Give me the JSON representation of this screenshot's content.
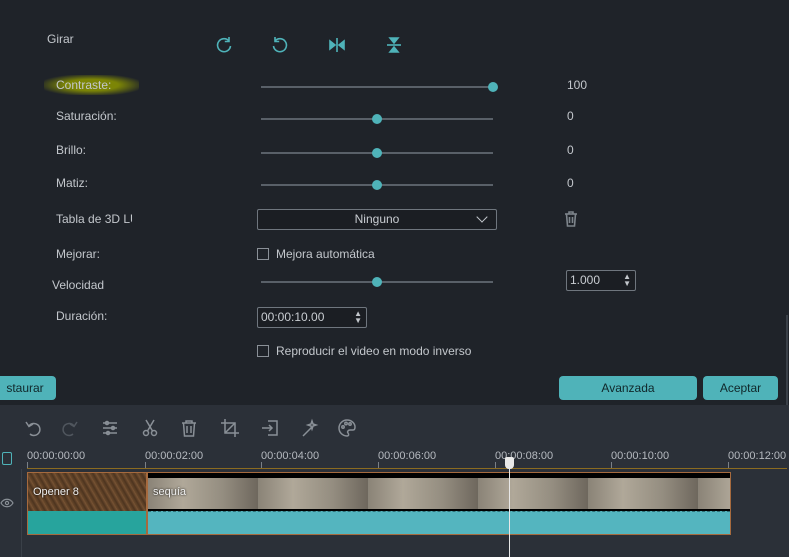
{
  "panel": {
    "rotate_label": "Girar",
    "contrast": {
      "label": "Contraste:",
      "value": "100",
      "level": 1.0
    },
    "saturation": {
      "label": "Saturación:",
      "value": "0",
      "level": 0.5
    },
    "brightness": {
      "label": "Brillo:",
      "value": "0",
      "level": 0.5
    },
    "hue": {
      "label": "Matiz:",
      "value": "0",
      "level": 0.5
    },
    "lut": {
      "label": "Tabla de 3D LU",
      "selected": "Ninguno"
    },
    "enhance": {
      "label": "Mejorar:",
      "checkbox_label": "Mejora automática",
      "checked": false
    },
    "speed": {
      "label": "Velocidad",
      "value": "1.000",
      "level": 0.5
    },
    "duration": {
      "label": "Duración:",
      "value": "00:00:10.00"
    },
    "reverse": {
      "checkbox_label": "Reproducir el video en modo inverso",
      "checked": false
    }
  },
  "buttons": {
    "restore": "staurar",
    "advanced": "Avanzada",
    "accept": "Aceptar"
  },
  "timeline": {
    "ruler": [
      "00:00:00:00",
      "00:00:02:00",
      "00:00:04:00",
      "00:00:06:00",
      "00:00:08:00",
      "00:00:10:00",
      "00:00:12:00"
    ],
    "clips": [
      {
        "name": "Opener 8"
      },
      {
        "name": "sequía"
      }
    ]
  },
  "colors": {
    "accent": "#4fb3b9",
    "clip_border": "#a66a3e",
    "highlight": "#8c9600"
  },
  "icons": {
    "rotate_cw": "rotate-cw-icon",
    "rotate_ccw": "rotate-ccw-icon",
    "flip_h": "flip-horizontal-icon",
    "flip_v": "flip-vertical-icon",
    "trash": "trash-icon"
  }
}
